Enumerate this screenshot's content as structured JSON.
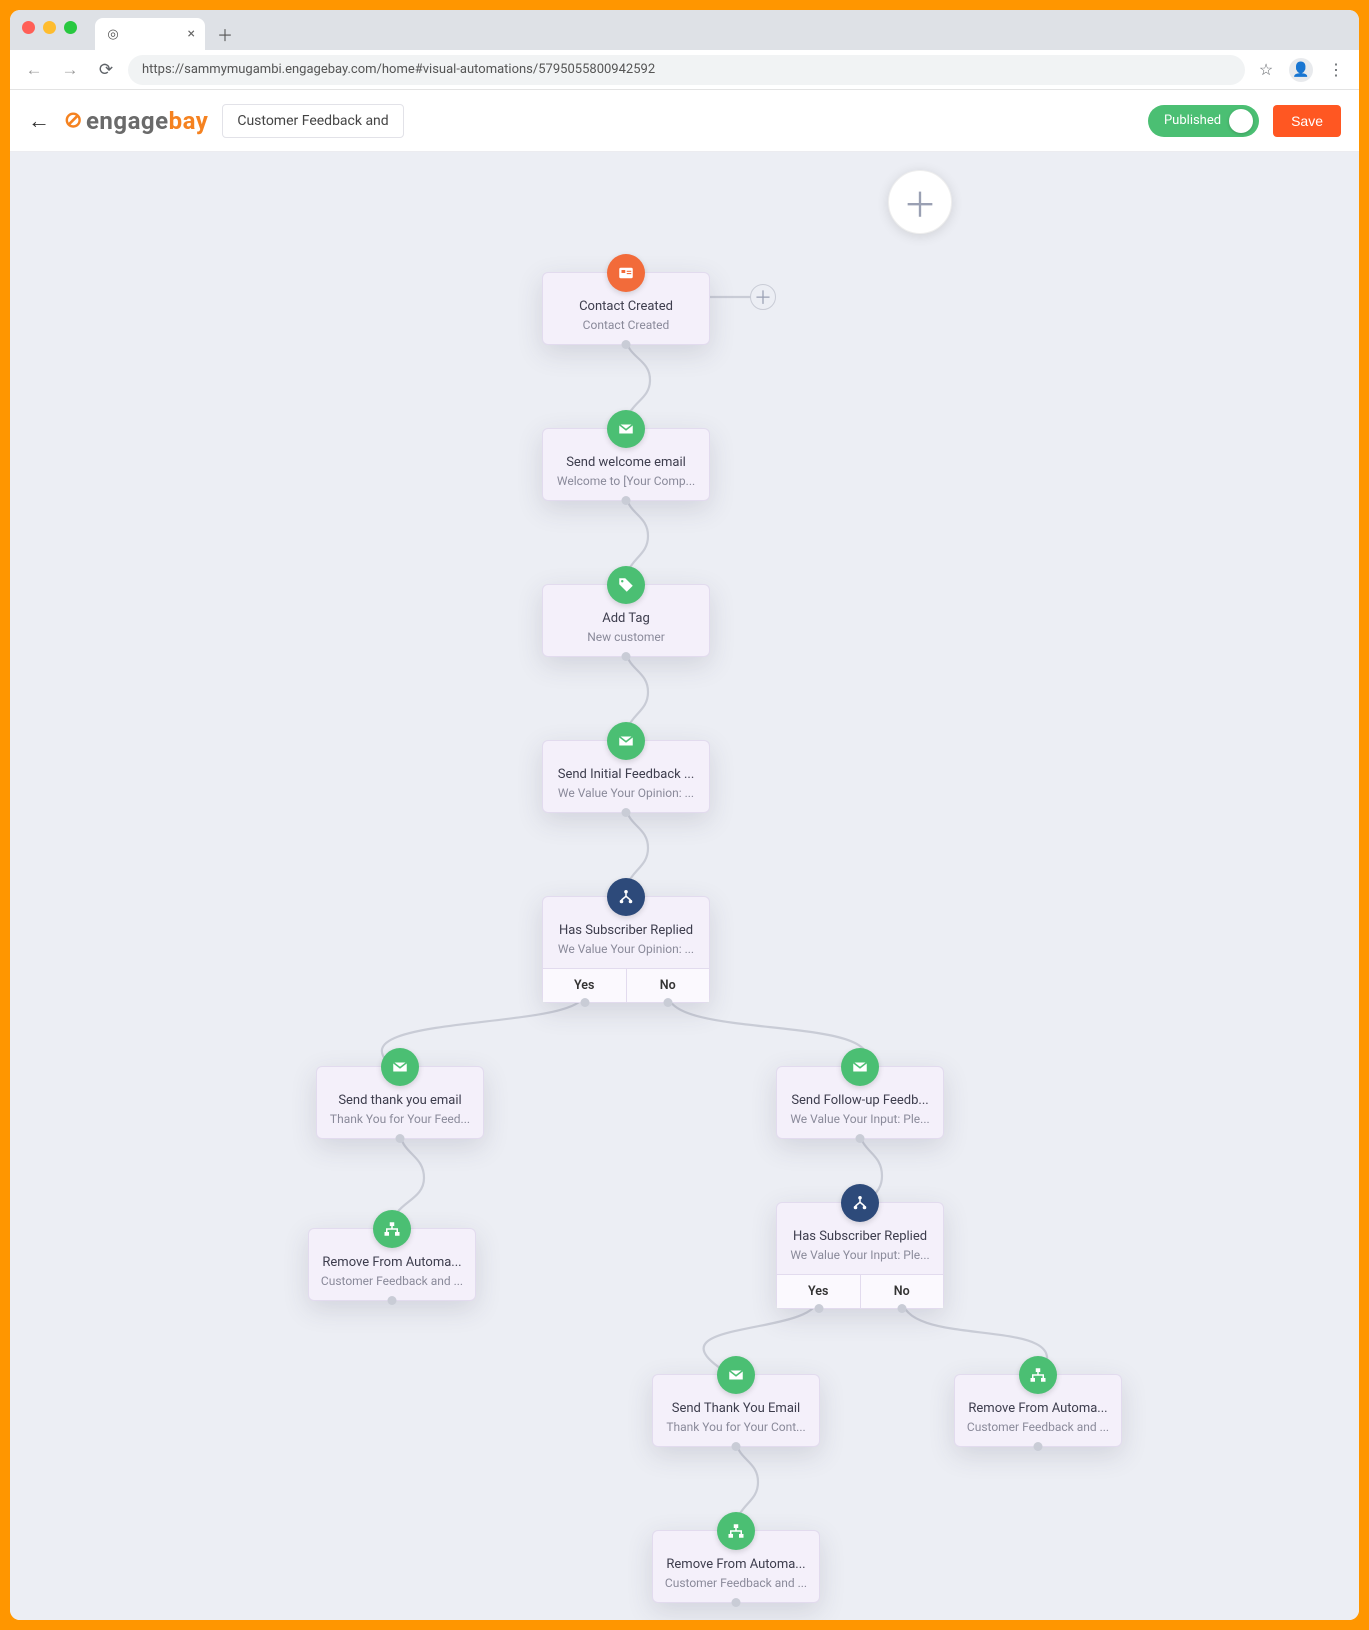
{
  "browser": {
    "url": "https://sammymugambi.engagebay.com/home#visual-automations/5795055800942592",
    "tab_title": ""
  },
  "header": {
    "logo_left": "engage",
    "logo_right": "bay",
    "automation_name": "Customer Feedback and",
    "publish_label": "Published",
    "save_label": "Save"
  },
  "nodes": {
    "n1": {
      "title": "Contact Created",
      "subtitle": "Contact Created"
    },
    "n2": {
      "title": "Send welcome email",
      "subtitle": "Welcome to [Your Comp..."
    },
    "n3": {
      "title": "Add Tag",
      "subtitle": "New customer"
    },
    "n4": {
      "title": "Send Initial Feedback ...",
      "subtitle": "We Value Your Opinion: ..."
    },
    "n5": {
      "title": "Has Subscriber Replied",
      "subtitle": "We Value Your Opinion: ...",
      "yes": "Yes",
      "no": "No"
    },
    "n6": {
      "title": "Send thank you email",
      "subtitle": "Thank You for Your Feed..."
    },
    "n7": {
      "title": "Remove From Automa...",
      "subtitle": "Customer Feedback and ..."
    },
    "n8": {
      "title": "Send Follow-up Feedb...",
      "subtitle": "We Value Your Input: Ple..."
    },
    "n9": {
      "title": "Has Subscriber Replied",
      "subtitle": "We Value Your Input: Ple...",
      "yes": "Yes",
      "no": "No"
    },
    "n10": {
      "title": "Send Thank You Email",
      "subtitle": "Thank You for Your Cont..."
    },
    "n11": {
      "title": "Remove From Automa...",
      "subtitle": "Customer Feedback and ..."
    },
    "n12": {
      "title": "Remove From Automa...",
      "subtitle": "Customer Feedback and ..."
    }
  }
}
